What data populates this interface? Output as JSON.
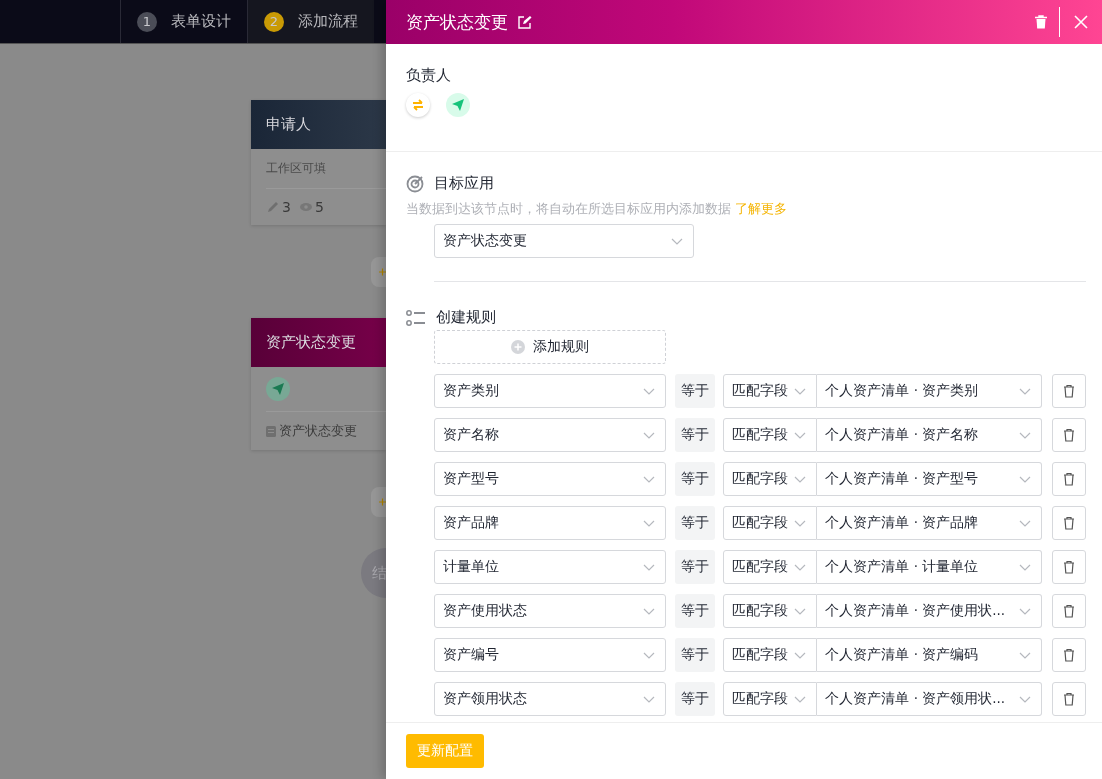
{
  "topbar": {
    "steps": [
      {
        "number": "1",
        "label": "表单设计",
        "selected": false
      },
      {
        "number": "2",
        "label": "添加流程",
        "selected": true
      }
    ]
  },
  "canvas": {
    "nodes": [
      {
        "kind": "applicant",
        "title": "申请人",
        "subtitle": "工作区可填",
        "edit_count": "3",
        "view_count": "5"
      },
      {
        "kind": "action",
        "title": "资产状态变更",
        "target": "资产状态变更"
      }
    ],
    "end_label": "结"
  },
  "drawer": {
    "title": "资产状态变更",
    "owner": {
      "label": "负责人"
    },
    "target": {
      "heading": "目标应用",
      "hint": "当数据到达该节点时，将自动在所选目标应用内添加数据",
      "link": "了解更多",
      "app": "资产状态变更"
    },
    "rules": {
      "heading": "创建规则",
      "add_button": "添加规则",
      "rows": [
        {
          "field": "资产类别",
          "operator": "等于",
          "mode": "匹配字段",
          "value": "个人资产清单 · 资产类别"
        },
        {
          "field": "资产名称",
          "operator": "等于",
          "mode": "匹配字段",
          "value": "个人资产清单 · 资产名称"
        },
        {
          "field": "资产型号",
          "operator": "等于",
          "mode": "匹配字段",
          "value": "个人资产清单 · 资产型号"
        },
        {
          "field": "资产品牌",
          "operator": "等于",
          "mode": "匹配字段",
          "value": "个人资产清单 · 资产品牌"
        },
        {
          "field": "计量单位",
          "operator": "等于",
          "mode": "匹配字段",
          "value": "个人资产清单 · 计量单位"
        },
        {
          "field": "资产使用状态",
          "operator": "等于",
          "mode": "匹配字段",
          "value": "个人资产清单 · 资产使用状..."
        },
        {
          "field": "资产编号",
          "operator": "等于",
          "mode": "匹配字段",
          "value": "个人资产清单 · 资产编码"
        },
        {
          "field": "资产领用状态",
          "operator": "等于",
          "mode": "匹配字段",
          "value": "个人资产清单 · 资产领用状..."
        }
      ]
    },
    "footer": {
      "button": "更新配置"
    }
  }
}
